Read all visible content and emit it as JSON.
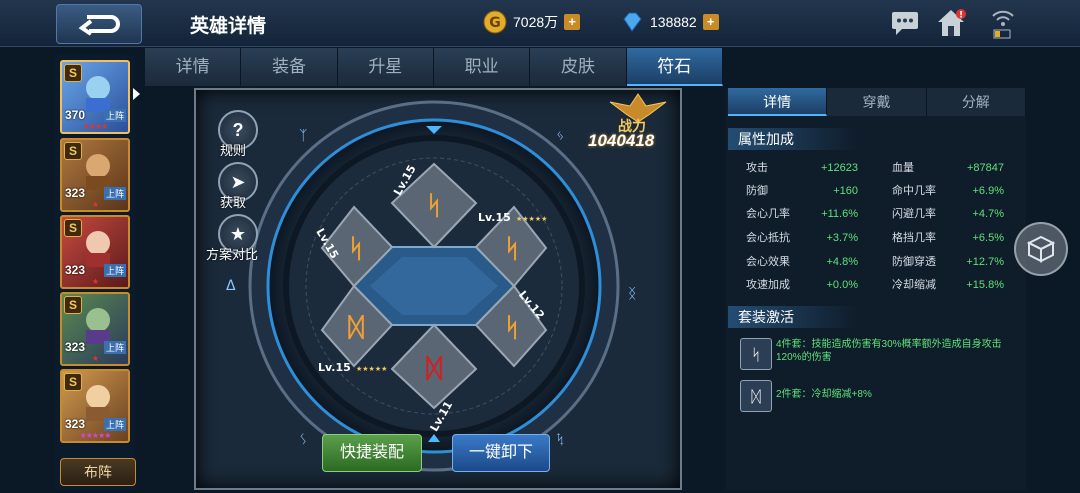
{
  "header": {
    "title": "英雄详情",
    "gold": "7028万",
    "gems": "138882",
    "plus": "+"
  },
  "tabs": [
    "详情",
    "装备",
    "升星",
    "职业",
    "皮肤",
    "符石"
  ],
  "active_tab": 5,
  "heroes": [
    {
      "level": "370",
      "tag": "上阵",
      "grade": "S",
      "stars": "★★★★"
    },
    {
      "level": "323",
      "tag": "上阵",
      "grade": "S",
      "stars": "★"
    },
    {
      "level": "323",
      "tag": "上阵",
      "grade": "S",
      "stars": "★"
    },
    {
      "level": "323",
      "tag": "上阵",
      "grade": "S",
      "stars": "★"
    },
    {
      "level": "323",
      "tag": "上阵",
      "grade": "S",
      "stars": "★★★★★"
    }
  ],
  "formation_label": "布阵",
  "side_buttons": {
    "rules": "规则",
    "obtain": "获取",
    "compare": "方案对比"
  },
  "power": {
    "label": "战力",
    "value": "1040418"
  },
  "runes": [
    {
      "level": "Lv.15"
    },
    {
      "level": "Lv.15"
    },
    {
      "level": "Lv.15"
    },
    {
      "level": "Lv.12"
    },
    {
      "level": "Lv.11"
    },
    {
      "level": "Lv.15"
    }
  ],
  "actions": {
    "quick_equip": "快捷装配",
    "unequip_all": "一键卸下"
  },
  "right_tabs": [
    "详情",
    "穿戴",
    "分解"
  ],
  "attr_section": "属性加成",
  "stats": [
    {
      "l1": "攻击",
      "v1": "+12623",
      "l2": "血量",
      "v2": "+87847"
    },
    {
      "l1": "防御",
      "v1": "+160",
      "l2": "命中几率",
      "v2": "+6.9%"
    },
    {
      "l1": "会心几率",
      "v1": "+11.6%",
      "l2": "闪避几率",
      "v2": "+4.7%"
    },
    {
      "l1": "会心抵抗",
      "v1": "+3.7%",
      "l2": "格挡几率",
      "v2": "+6.5%"
    },
    {
      "l1": "会心效果",
      "v1": "+4.8%",
      "l2": "防御穿透",
      "v2": "+12.7%"
    },
    {
      "l1": "攻速加成",
      "v1": "+0.0%",
      "l2": "冷却缩减",
      "v2": "+15.8%"
    }
  ],
  "set_section": "套装激活",
  "sets": [
    {
      "text": "4件套：技能造成伤害有30%概率额外造成自身攻击120%的伤害"
    },
    {
      "text": "2件套：冷却缩减+8%"
    }
  ],
  "colors": {
    "accent": "#4db8ff",
    "stat_value": "#5fe27a",
    "gold": "#c88a2b"
  }
}
